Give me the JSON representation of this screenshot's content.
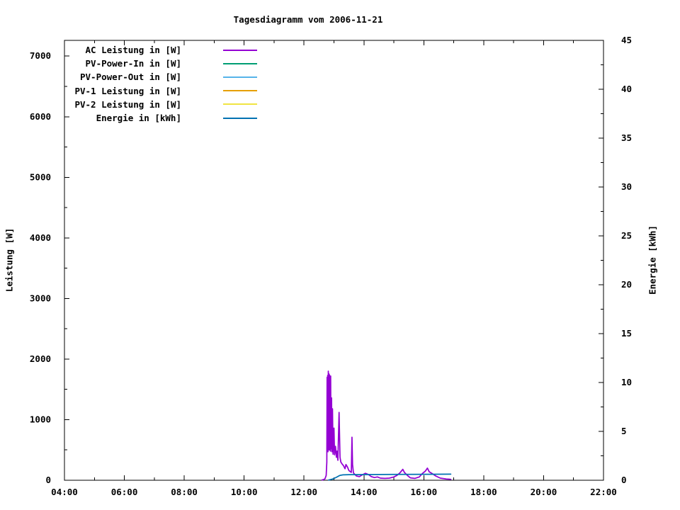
{
  "chart_data": {
    "type": "line",
    "title": "Tagesdiagramm vom 2006-11-21",
    "xlabel": "",
    "ylabel": "Leistung [W]",
    "y2label": "Energie [kWh]",
    "x_axis": {
      "unit": "time",
      "start_hour": 4,
      "end_hour": 22,
      "major_tick_hours": [
        4,
        6,
        8,
        10,
        12,
        14,
        16,
        18,
        20,
        22
      ],
      "tick_labels": [
        "04:00",
        "06:00",
        "08:00",
        "10:00",
        "12:00",
        "14:00",
        "16:00",
        "18:00",
        "20:00",
        "22:00"
      ],
      "minor_step_hours": 1
    },
    "y_axis": {
      "range": [
        0,
        7260
      ],
      "major_tick_values": [
        0,
        1000,
        2000,
        3000,
        4000,
        5000,
        6000,
        7000
      ],
      "tick_labels": [
        "0",
        "1000",
        "2000",
        "3000",
        "4000",
        "5000",
        "6000",
        "7000"
      ],
      "minor_step": 500
    },
    "y2_axis": {
      "range": [
        0,
        45
      ],
      "major_tick_values": [
        0,
        5,
        10,
        15,
        20,
        25,
        30,
        35,
        40,
        45
      ],
      "tick_labels": [
        "0",
        "5",
        "10",
        "15",
        "20",
        "25",
        "30",
        "35",
        "40",
        "45"
      ],
      "minor_step": 2.5
    },
    "grid": "off",
    "legend_position": "top-left-inside",
    "series": [
      {
        "name": "AC Leistung in [W]",
        "color": "#9400d3",
        "axis": "y1",
        "points": [
          [
            12.6,
            5
          ],
          [
            12.65,
            10
          ],
          [
            12.7,
            25
          ],
          [
            12.74,
            80
          ],
          [
            12.76,
            300
          ],
          [
            12.77,
            1700
          ],
          [
            12.78,
            520
          ],
          [
            12.79,
            1730
          ],
          [
            12.8,
            470
          ],
          [
            12.81,
            1800
          ],
          [
            12.82,
            640
          ],
          [
            12.83,
            1760
          ],
          [
            12.84,
            500
          ],
          [
            12.85,
            1740
          ],
          [
            12.86,
            900
          ],
          [
            12.87,
            1500
          ],
          [
            12.88,
            480
          ],
          [
            12.89,
            1720
          ],
          [
            12.9,
            520
          ],
          [
            12.92,
            1360
          ],
          [
            12.93,
            470
          ],
          [
            12.95,
            1180
          ],
          [
            12.97,
            430
          ],
          [
            13.0,
            860
          ],
          [
            13.02,
            420
          ],
          [
            13.05,
            560
          ],
          [
            13.08,
            380
          ],
          [
            13.1,
            480
          ],
          [
            13.13,
            330
          ],
          [
            13.17,
            1120
          ],
          [
            13.2,
            380
          ],
          [
            13.23,
            300
          ],
          [
            13.27,
            270
          ],
          [
            13.32,
            240
          ],
          [
            13.37,
            190
          ],
          [
            13.4,
            260
          ],
          [
            13.45,
            220
          ],
          [
            13.5,
            160
          ],
          [
            13.55,
            140
          ],
          [
            13.58,
            130
          ],
          [
            13.6,
            710
          ],
          [
            13.62,
            260
          ],
          [
            13.65,
            120
          ],
          [
            13.75,
            70
          ],
          [
            13.85,
            60
          ],
          [
            13.95,
            90
          ],
          [
            14.05,
            115
          ],
          [
            14.15,
            95
          ],
          [
            14.25,
            60
          ],
          [
            14.35,
            45
          ],
          [
            14.45,
            55
          ],
          [
            14.55,
            35
          ],
          [
            14.7,
            30
          ],
          [
            14.85,
            35
          ],
          [
            15.0,
            55
          ],
          [
            15.1,
            80
          ],
          [
            15.2,
            120
          ],
          [
            15.3,
            180
          ],
          [
            15.35,
            130
          ],
          [
            15.45,
            80
          ],
          [
            15.55,
            40
          ],
          [
            15.7,
            30
          ],
          [
            15.85,
            55
          ],
          [
            15.95,
            110
          ],
          [
            16.05,
            150
          ],
          [
            16.12,
            200
          ],
          [
            16.18,
            140
          ],
          [
            16.28,
            110
          ],
          [
            16.4,
            70
          ],
          [
            16.55,
            35
          ],
          [
            16.75,
            20
          ],
          [
            16.9,
            15
          ]
        ]
      },
      {
        "name": "PV-Power-In in [W]",
        "color": "#009e73",
        "axis": "y1",
        "points": []
      },
      {
        "name": "PV-Power-Out in [W]",
        "color": "#56b4e9",
        "axis": "y1",
        "points": []
      },
      {
        "name": "PV-1 Leistung in [W]",
        "color": "#e69f00",
        "axis": "y1",
        "points": []
      },
      {
        "name": "PV-2 Leistung in [W]",
        "color": "#f0e442",
        "axis": "y1",
        "points": []
      },
      {
        "name": "Energie in [kWh]",
        "color": "#0072b2",
        "axis": "y2",
        "points": [
          [
            12.82,
            0.02
          ],
          [
            12.9,
            0.08
          ],
          [
            12.95,
            0.12
          ],
          [
            13.0,
            0.18
          ],
          [
            13.05,
            0.25
          ],
          [
            13.1,
            0.33
          ],
          [
            13.15,
            0.42
          ],
          [
            13.2,
            0.5
          ],
          [
            13.3,
            0.55
          ],
          [
            13.5,
            0.57
          ],
          [
            14.0,
            0.58
          ],
          [
            15.0,
            0.6
          ],
          [
            16.0,
            0.61
          ],
          [
            16.9,
            0.62
          ]
        ]
      }
    ]
  }
}
